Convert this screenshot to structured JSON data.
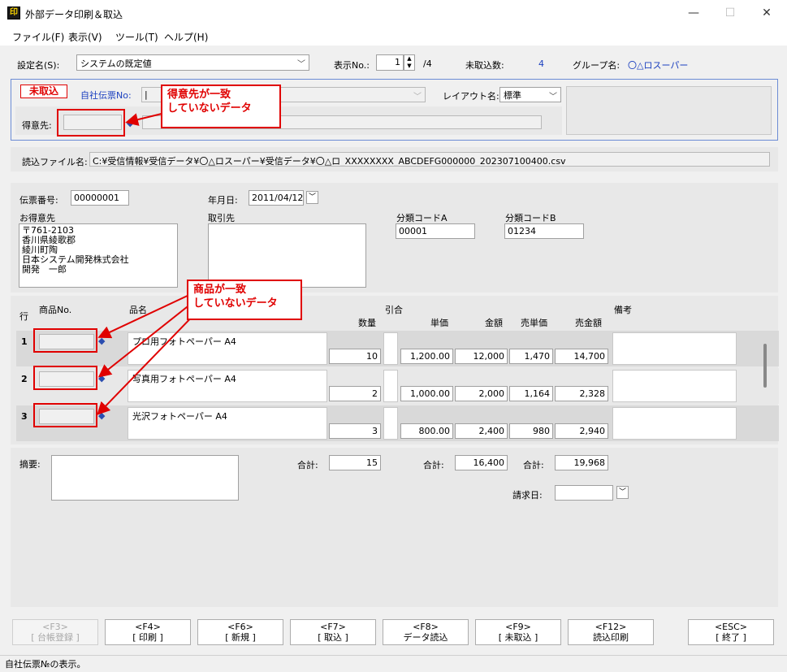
{
  "window": {
    "title": "外部データ印刷＆取込",
    "app_icon": "印",
    "min": "—",
    "max": "☐",
    "close": "✕"
  },
  "menu": [
    {
      "label": "ファイル(F)"
    },
    {
      "label": "表示(V)"
    },
    {
      "label": "ツール(T)"
    },
    {
      "label": "ヘルプ(H)"
    }
  ],
  "header": {
    "setting_label": "設定名(S):",
    "setting_value": "システムの既定値",
    "display_label": "表示No.:",
    "display_value": "1",
    "display_total": "/4",
    "pending_label": "未取込数:",
    "pending_value": "4",
    "group_label": "グループ名:",
    "group_value": "〇△ロスーパー"
  },
  "status_panel": {
    "badge": "未取込",
    "slip_label": "自社伝票No:",
    "slip_value": "|",
    "layout_label": "レイアウト名:",
    "layout_value": "標準",
    "customer_label": "得意先:",
    "customer_value": ""
  },
  "file": {
    "label": "読込ファイル名:",
    "path": "C:¥受信情報¥受信データ¥〇△ロスーパー¥受信データ¥〇△ロ_XXXXXXXX_ABCDEFG000000_202307100400.csv"
  },
  "slip": {
    "number_label": "伝票番号:",
    "number_value": "00000001",
    "date_label": "年月日:",
    "date_value": "2011/04/12",
    "customer_label": "お得意先",
    "customer_lines": [
      "〒761-2103",
      "香川県綾歌郡",
      "綾川町陶",
      "日本システム開発株式会社",
      "開発　一郎"
    ],
    "supplier_label": "取引先",
    "classA_label": "分類コードA",
    "classA_value": "00001",
    "classB_label": "分類コードB",
    "classB_value": "01234"
  },
  "grid": {
    "headers": {
      "row": "行",
      "code": "商品No.",
      "name": "品名",
      "discount": "引合",
      "qty": "数量",
      "price": "単価",
      "amount": "金額",
      "sell_price": "売単価",
      "sell_amount": "売金額",
      "note": "備考"
    },
    "rows": [
      {
        "no": "1",
        "code": "",
        "name": "プロ用フォトペーパー A4",
        "qty": "10",
        "price": "1,200.00",
        "amount": "12,000",
        "sell_price": "1,470",
        "sell_amount": "14,700",
        "note": ""
      },
      {
        "no": "2",
        "code": "",
        "name": "写真用フォトペーパー A4",
        "qty": "2",
        "price": "1,000.00",
        "amount": "2,000",
        "sell_price": "1,164",
        "sell_amount": "2,328",
        "note": ""
      },
      {
        "no": "3",
        "code": "",
        "name": "光沢フォトペーパー A4",
        "qty": "3",
        "price": "800.00",
        "amount": "2,400",
        "sell_price": "980",
        "sell_amount": "2,940",
        "note": ""
      }
    ]
  },
  "summary": {
    "memo_label": "摘要:",
    "qty_total_label": "合計:",
    "qty_total": "15",
    "amount_total_label": "合計:",
    "amount_total": "16,400",
    "sell_total_label": "合計:",
    "sell_total": "19,968",
    "bill_date_label": "請求日:",
    "bill_date_value": ""
  },
  "callouts": {
    "customer": [
      "得意先が一致",
      "していないデータ"
    ],
    "product": [
      "商品が一致",
      "していないデータ"
    ]
  },
  "fkeys": [
    {
      "key": "<F3>",
      "label": "[ 台帳登録 ]",
      "enabled": false
    },
    {
      "key": "<F4>",
      "label": "[ 印刷 ]",
      "enabled": true
    },
    {
      "key": "<F6>",
      "label": "[ 新規 ]",
      "enabled": true
    },
    {
      "key": "<F7>",
      "label": "[ 取込 ]",
      "enabled": true
    },
    {
      "key": "<F8>",
      "label": "データ読込",
      "enabled": true
    },
    {
      "key": "<F9>",
      "label": "[ 未取込 ]",
      "enabled": true
    },
    {
      "key": "<F12>",
      "label": "読込印刷",
      "enabled": true
    },
    {
      "key": "<ESC>",
      "label": "[ 終了 ]",
      "enabled": true
    }
  ],
  "statusbar": {
    "text": "自社伝票№の表示。"
  },
  "colors": {
    "accent": "#1a3fbf",
    "alert": "#e00000",
    "rowband": "#d9d9d9"
  }
}
